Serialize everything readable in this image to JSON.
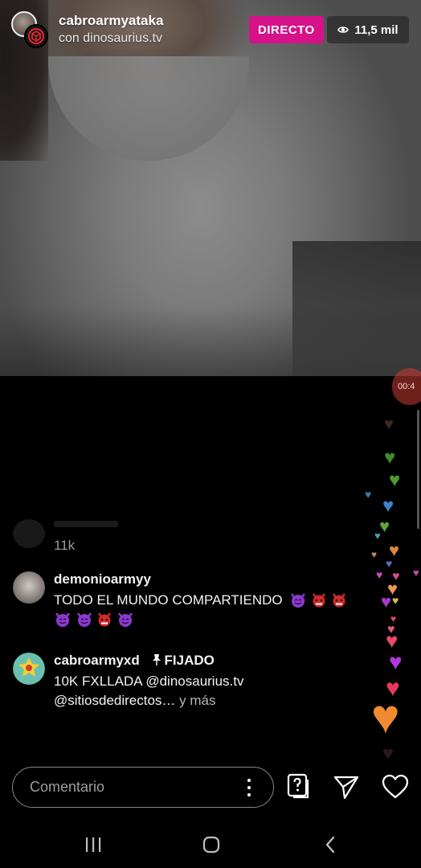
{
  "header": {
    "username": "cabroarmyataka",
    "with_line": "con dinosaurius.tv",
    "live_label": "DIRECTO",
    "viewer_count": "11,5 mil",
    "viewer_icon": "eye-icon"
  },
  "stream": {
    "timer_fragment": "00:4"
  },
  "comments": {
    "ghost_count": "11k",
    "items": [
      {
        "username": "demonioarmyy",
        "text": "TODO EL MUNDO COMPARTIENDO"
      },
      {
        "username": "cabroarmyxd",
        "pinned_label": "FIJADO",
        "text_line1": "10K FXLLADA @dinosaurius.tv",
        "text_line2": "@sitiosdedirectos…",
        "more_label": "y más"
      }
    ]
  },
  "bottom_bar": {
    "comment_placeholder": "Comentario",
    "icons": [
      "more-vertical-icon",
      "question-card-icon",
      "send-icon",
      "heart-icon"
    ]
  },
  "colors": {
    "live_badge": "#d6128a",
    "background": "#000000"
  }
}
